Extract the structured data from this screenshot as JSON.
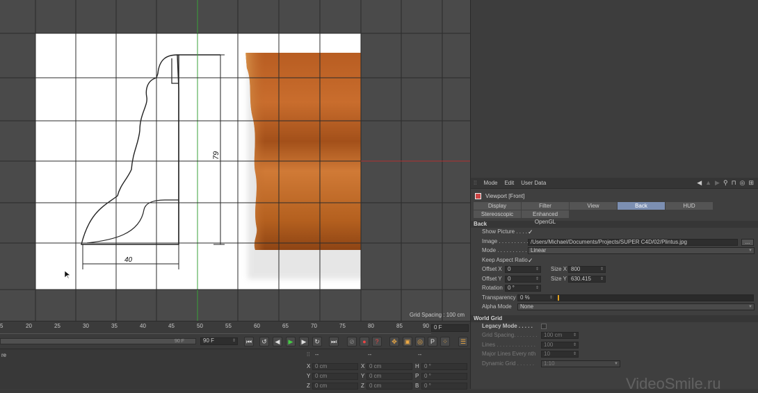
{
  "viewport": {
    "grid_spacing_label": "Grid Spacing : 100 cm",
    "drawing": {
      "height_dimension": "79",
      "width_dimension": "40"
    }
  },
  "attribute_manager": {
    "menu": [
      "Mode",
      "Edit",
      "User Data"
    ],
    "title": "Viewport [Front]",
    "tabs_row1": [
      "Display",
      "Filter",
      "View",
      "Back",
      "HUD"
    ],
    "tabs_row2": [
      "Stereoscopic",
      "Enhanced OpenGL"
    ],
    "active_tab": "Back",
    "back_section": "Back",
    "show_picture_label": "Show Picture . . . . .",
    "image_label": "Image . . . . . . . . . .",
    "image_path": "/Users/Michael/Documents/Projects/SUPER C4D/02/Plintus.jpg",
    "image_browse": "...",
    "mode_label": "Mode . . . . . . . . . .",
    "mode_value": "Linear",
    "keep_aspect_label": "Keep Aspect Ratio",
    "offset_x_label": "Offset X",
    "offset_x": "0",
    "offset_y_label": "Offset Y",
    "offset_y": "0",
    "size_x_label": "Size X",
    "size_x": "800",
    "size_y_label": "Size Y",
    "size_y": "630.415",
    "rotation_label": "Rotation",
    "rotation": "0 °",
    "transparency_label": "Transparency",
    "transparency": "0 %",
    "alpha_mode_label": "Alpha Mode",
    "alpha_mode": "None",
    "world_grid_section": "World Grid",
    "legacy_mode_label": "Legacy Mode . . . . .",
    "grid_spacing_label": "Grid Spacing. . . . . . . .",
    "grid_spacing": "100 cm",
    "lines_label": "Lines . . . . . . . . . . . . .",
    "lines": "100",
    "major_lines_label": "Major Lines Every nth",
    "major_lines": "10",
    "dynamic_grid_label": "Dynamic Grid . . . . . .",
    "dynamic_grid": "1:10"
  },
  "timeline": {
    "ticks": [
      "5",
      "20",
      "25",
      "30",
      "35",
      "40",
      "45",
      "50",
      "55",
      "60",
      "65",
      "70",
      "75",
      "80",
      "85",
      "90"
    ],
    "current_frame": "0 F",
    "end_frame_small": "90 F",
    "end_frame": "90 F"
  },
  "coordinates": {
    "header": [
      "--",
      "--",
      "--"
    ],
    "left_label": "re",
    "rows": [
      {
        "a": "X",
        "av": "0 cm",
        "b": "X",
        "bv": "0 cm",
        "c": "H",
        "cv": "0 °"
      },
      {
        "a": "Y",
        "av": "0 cm",
        "b": "Y",
        "bv": "0 cm",
        "c": "P",
        "cv": "0 °"
      },
      {
        "a": "Z",
        "av": "0 cm",
        "b": "Z",
        "bv": "0 cm",
        "c": "B",
        "cv": "0 °"
      }
    ]
  },
  "watermark": "VideoSmile.ru"
}
